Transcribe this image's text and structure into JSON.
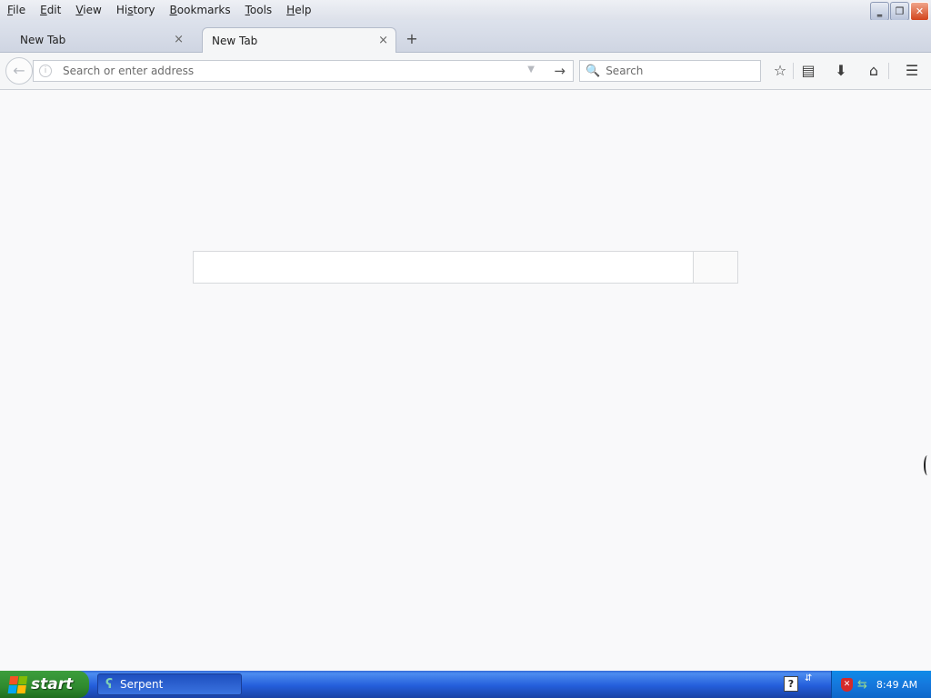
{
  "menubar": {
    "items": [
      {
        "pre": "",
        "ul": "F",
        "post": "ile"
      },
      {
        "pre": "",
        "ul": "E",
        "post": "dit"
      },
      {
        "pre": "",
        "ul": "V",
        "post": "iew"
      },
      {
        "pre": "Hi",
        "ul": "s",
        "post": "tory"
      },
      {
        "pre": "",
        "ul": "B",
        "post": "ookmarks"
      },
      {
        "pre": "",
        "ul": "T",
        "post": "ools"
      },
      {
        "pre": "",
        "ul": "H",
        "post": "elp"
      }
    ]
  },
  "window_controls": {
    "minimize": "‗",
    "restore": "❐",
    "close": "✕"
  },
  "tabs": [
    {
      "label": "New Tab",
      "close": "×"
    },
    {
      "label": "New Tab",
      "close": "×"
    }
  ],
  "new_tab_symbol": "+",
  "navbar": {
    "back_symbol": "←",
    "info_symbol": "i",
    "url_placeholder": "Search or enter address",
    "url_value": "",
    "dropmarker_symbol": "▼",
    "go_symbol": "→",
    "search_symbol": "🔍",
    "search_placeholder": "Search",
    "search_value": "",
    "star_symbol": "☆",
    "reading_symbol": "▤",
    "download_symbol": "⬇",
    "home_symbol": "⌂",
    "menu_symbol": "☰"
  },
  "newtab_search": {
    "placeholder": "",
    "value": ""
  },
  "taskbar": {
    "start_label": "start",
    "task_label": "Serpent",
    "task_icon": "ʕ",
    "help_symbol": "?",
    "lang_symbol": "⇵",
    "shield_symbol": "✕",
    "net_symbol": "⇆",
    "clock": "8:49 AM"
  }
}
